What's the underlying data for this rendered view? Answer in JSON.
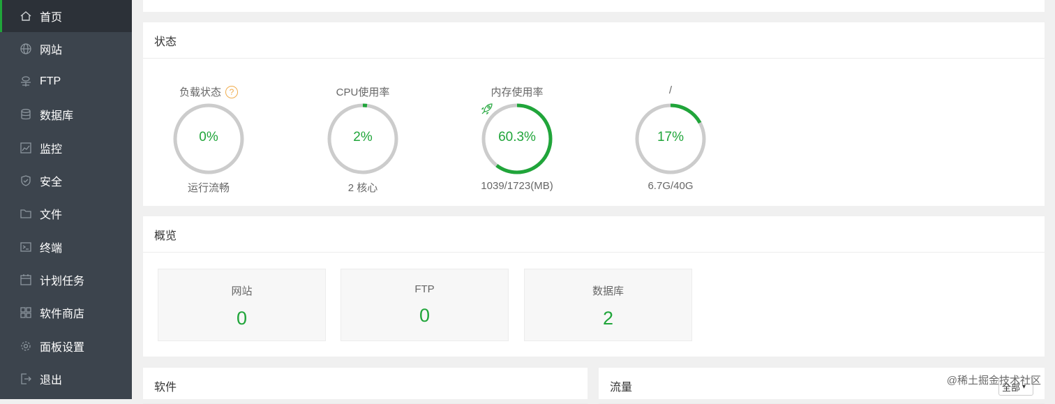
{
  "sidebar": {
    "items": [
      {
        "label": "首页",
        "icon": "home-icon",
        "active": true
      },
      {
        "label": "网站",
        "icon": "globe-icon"
      },
      {
        "label": "FTP",
        "icon": "ftp-icon"
      },
      {
        "label": "数据库",
        "icon": "database-icon"
      },
      {
        "label": "监控",
        "icon": "monitor-icon"
      },
      {
        "label": "安全",
        "icon": "shield-icon"
      },
      {
        "label": "文件",
        "icon": "folder-icon"
      },
      {
        "label": "终端",
        "icon": "terminal-icon"
      },
      {
        "label": "计划任务",
        "icon": "calendar-icon"
      },
      {
        "label": "软件商店",
        "icon": "grid-icon"
      },
      {
        "label": "面板设置",
        "icon": "gear-icon"
      },
      {
        "label": "退出",
        "icon": "logout-icon"
      }
    ]
  },
  "status": {
    "title": "状态",
    "gauges": [
      {
        "title": "负载状态",
        "value": "0%",
        "percent": 0,
        "sub": "运行流畅",
        "help": "?"
      },
      {
        "title": "CPU使用率",
        "value": "2%",
        "percent": 2,
        "sub": "2 核心"
      },
      {
        "title": "内存使用率",
        "value": "60.3%",
        "percent": 60.3,
        "sub": "1039/1723(MB)"
      },
      {
        "title": "/",
        "value": "17%",
        "percent": 17,
        "sub": "6.7G/40G"
      }
    ]
  },
  "overview": {
    "title": "概览",
    "cards": [
      {
        "label": "网站",
        "value": "0"
      },
      {
        "label": "FTP",
        "value": "0"
      },
      {
        "label": "数据库",
        "value": "2"
      }
    ]
  },
  "software": {
    "title": "软件"
  },
  "traffic": {
    "title": "流量",
    "select_value": "全部"
  },
  "watermark": "@稀土掘金技术社区",
  "colors": {
    "accent": "#20a53a",
    "sidebar": "#3c444d",
    "track": "#cccccc",
    "help": "#f0ad4e"
  }
}
